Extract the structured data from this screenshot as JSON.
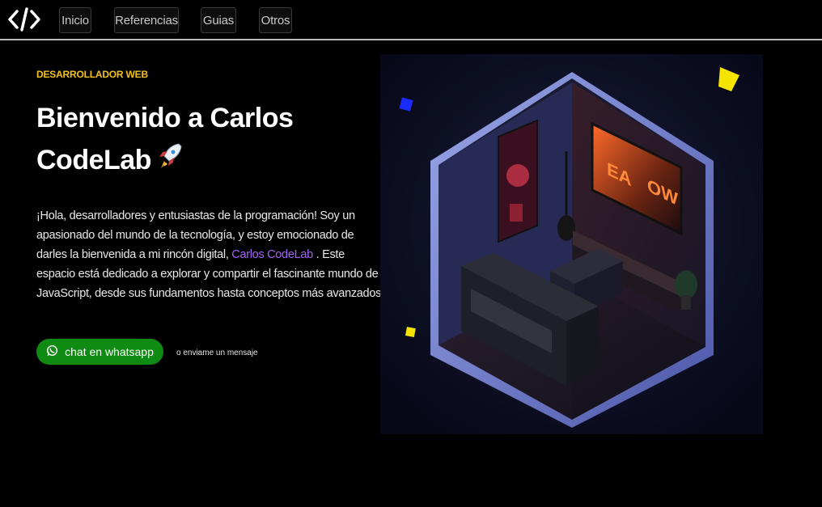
{
  "nav": {
    "logo_icon": "code-brackets-icon",
    "items": [
      {
        "label": "Inicio"
      },
      {
        "label": "Referencias"
      },
      {
        "label": "Guias"
      },
      {
        "label": "Otros"
      }
    ]
  },
  "hero": {
    "eyebrow": "DESARROLLADOR WEB",
    "title": "Bienvenido a Carlos CodeLab",
    "title_emoji_icon": "rocket-icon",
    "intro_before": "¡Hola, desarrolladores y entusiastas de la programación! Soy un apasionado del mundo de la tecnología, y estoy emocionado de darles la bienvenida a mi rincón digital, ",
    "intro_link": "Carlos CodeLab",
    "intro_after": " . Este espacio está dedicado a explorar y compartir el fascinante mundo de JavaScript, desde sus fundamentos hasta conceptos más avanzados.",
    "cta_label": "chat en whatsapp",
    "cta_icon": "whatsapp-icon",
    "secondary_link": "o enviame un mensaje",
    "image_subject": "isometric-gaming-room-illustration"
  },
  "colors": {
    "accent_yellow": "#f2c21b",
    "link_purple": "#a463f2",
    "whatsapp_green": "#0f8a12"
  }
}
